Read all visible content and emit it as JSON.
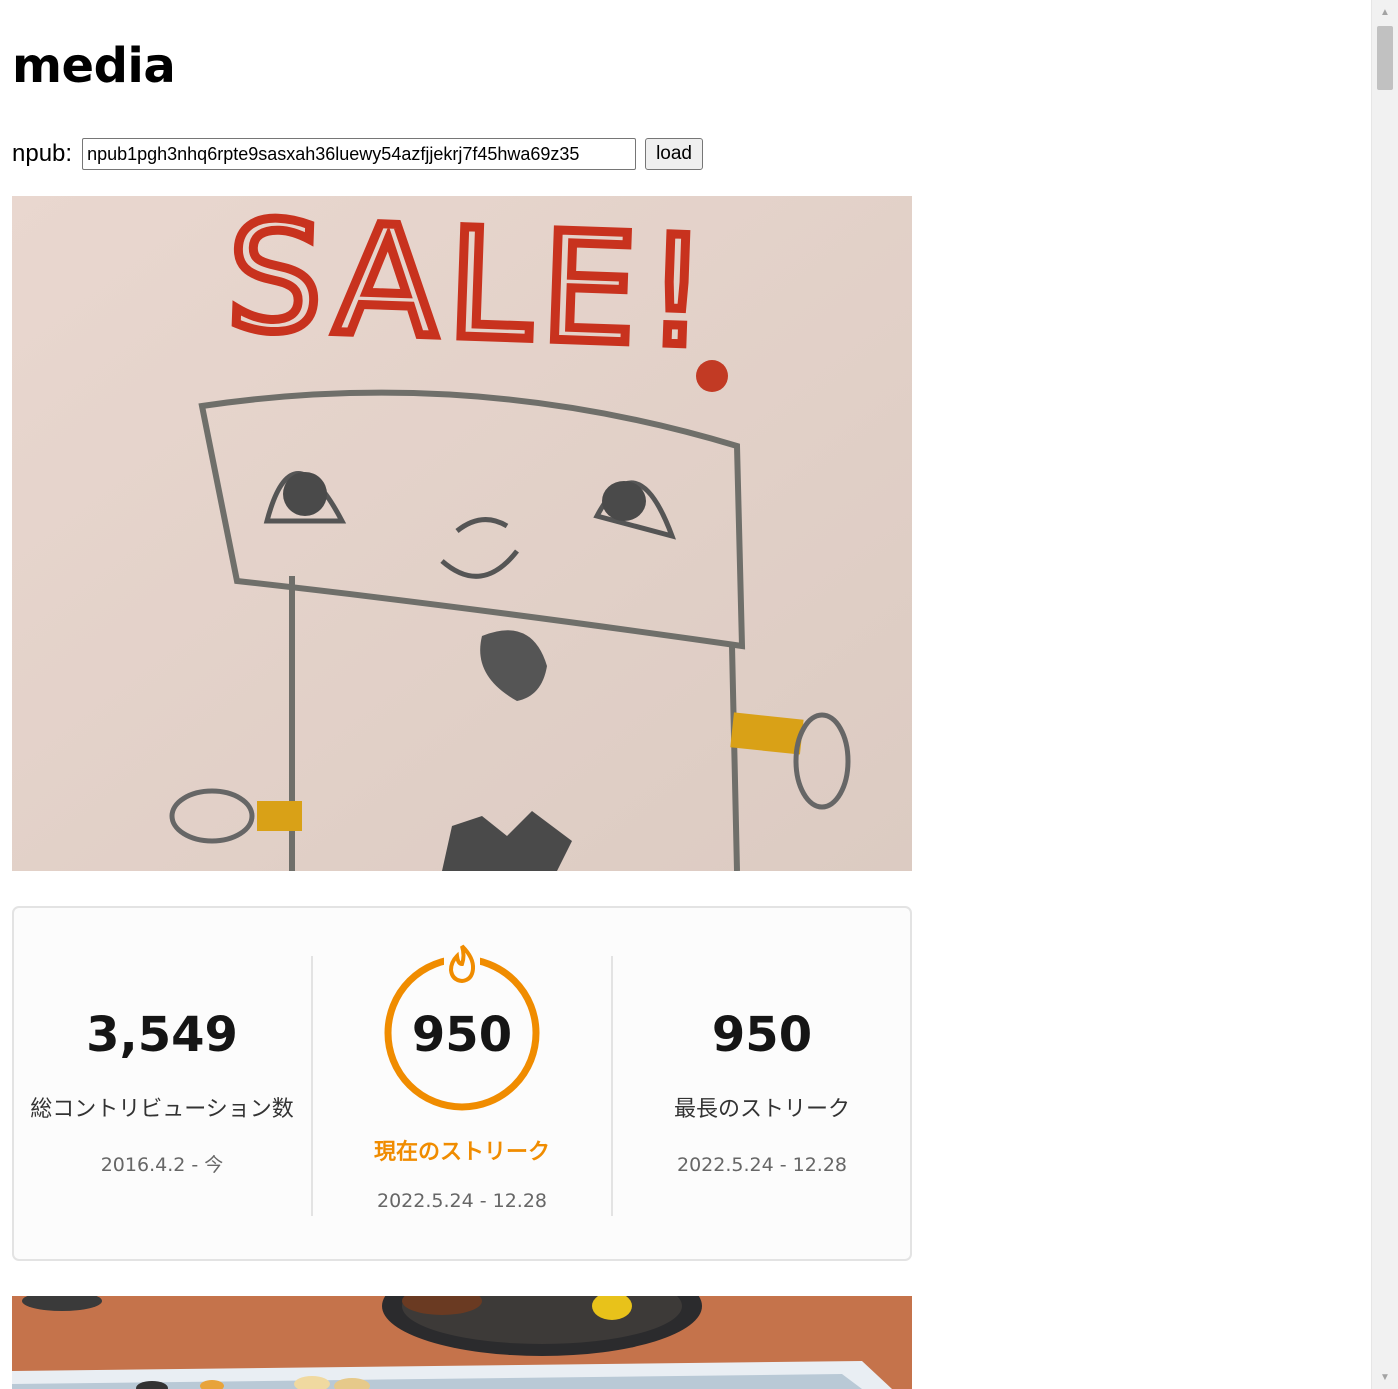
{
  "header": {
    "title": "media"
  },
  "npub_form": {
    "label": "npub:",
    "value": "npub1pgh3nhq6rpte9sasxah36luewy54azfjjekrj7f45hwa69z35",
    "load_label": "load"
  },
  "media": [
    {
      "kind": "drawing",
      "icon": "robot-sale-drawing-image",
      "text": "SALE!"
    },
    {
      "kind": "streak-card",
      "stats": [
        {
          "value": "3,549",
          "label": "総コントリビューション数",
          "range": "2016.4.2 - 今"
        },
        {
          "value": "950",
          "label": "現在のストリーク",
          "range": "2022.5.24 - 12.28",
          "accent": "#f08c00"
        },
        {
          "value": "950",
          "label": "最長のストリーク",
          "range": "2022.5.24 - 12.28"
        }
      ]
    },
    {
      "kind": "photo",
      "icon": "food-photo-image"
    }
  ],
  "colors": {
    "accent_orange": "#f08c00",
    "sale_red": "#c8321e",
    "paper": "#e6d6ce"
  }
}
